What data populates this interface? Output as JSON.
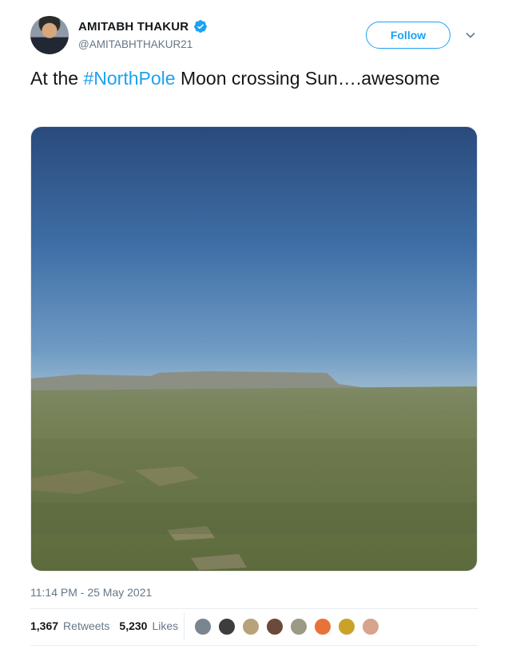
{
  "author": {
    "name": "AMITABH THAKUR",
    "handle": "@AMITABHTHAKUR21",
    "verified_icon": "verified-badge-icon"
  },
  "actions": {
    "follow_label": "Follow",
    "more_icon": "chevron-down-icon"
  },
  "tweet": {
    "text_before": "At the ",
    "hashtag": "#NorthPole",
    "text_after": " Moon crossing Sun….awesome",
    "media": "video-thumbnail-grassland-sky"
  },
  "meta": {
    "timestamp": "11:14 PM - 25 May 2021"
  },
  "stats": {
    "retweets_count": "1,367",
    "retweets_label": "Retweets",
    "likes_count": "5,230",
    "likes_label": "Likes"
  },
  "likers": [
    {
      "color": "#7a8590"
    },
    {
      "color": "#3d3d3d"
    },
    {
      "color": "#b8a27a"
    },
    {
      "color": "#6b4a3a"
    },
    {
      "color": "#9a9a86"
    },
    {
      "color": "#e8733a"
    },
    {
      "color": "#c9a227"
    },
    {
      "color": "#d7a48c"
    }
  ],
  "colors": {
    "accent": "#1da1f2",
    "secondary_text": "#657786"
  }
}
